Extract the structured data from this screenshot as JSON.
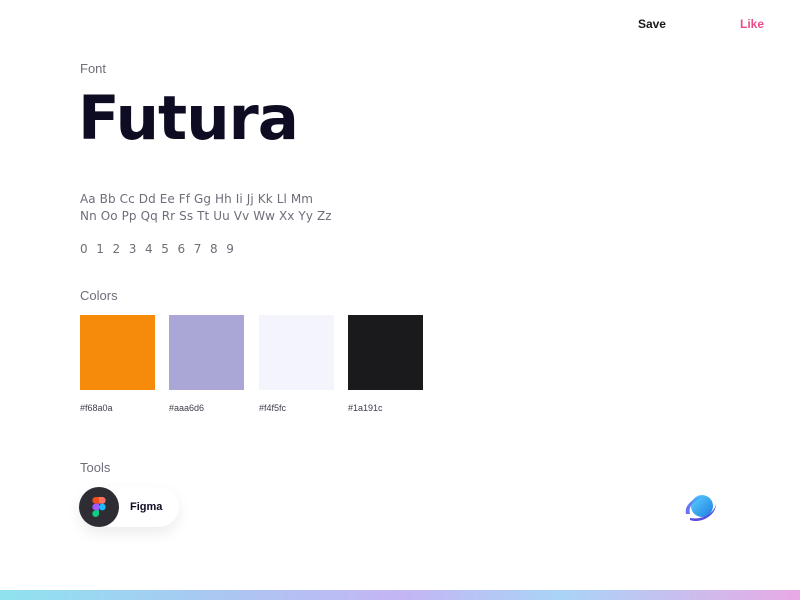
{
  "header": {
    "save_label": "Save",
    "like_label": "Like"
  },
  "font_section": {
    "label": "Font",
    "font_name": "Futura",
    "alphabet_line1": "Aa Bb Cc Dd Ee Ff Gg Hh Ii Jj Kk Ll Mm",
    "alphabet_line2": "Nn Oo Pp Qq Rr Ss Tt Uu Vv Ww Xx Yy Zz",
    "digits": "0 1 2 3 4 5 6 7 8 9"
  },
  "colors_section": {
    "label": "Colors",
    "swatches": [
      {
        "hex": "#f68a0a",
        "label": "#f68a0a"
      },
      {
        "hex": "#aaa6d6",
        "label": "#aaa6d6"
      },
      {
        "hex": "#f4f5fc",
        "label": "#f4f5fc"
      },
      {
        "hex": "#1a191c",
        "label": "#1a191c"
      }
    ]
  },
  "tools_section": {
    "label": "Tools",
    "tools": [
      {
        "name": "Figma",
        "icon": "figma-icon"
      }
    ]
  },
  "brand": {
    "icon": "orbit-logo-icon"
  },
  "accent_colors": {
    "like": "#ea4c89",
    "text_dark": "#0d0c22",
    "text_muted": "#6e6d7a"
  }
}
